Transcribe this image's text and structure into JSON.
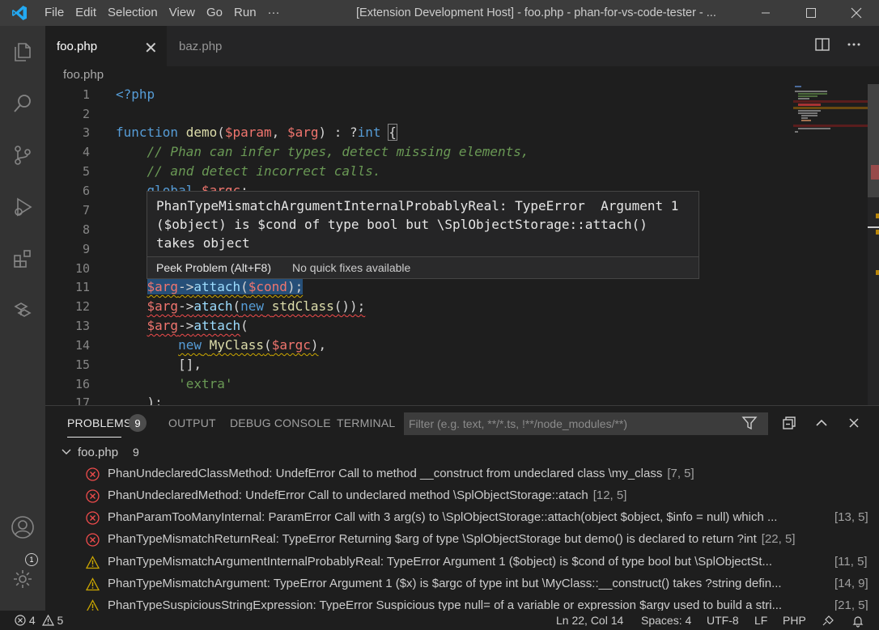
{
  "titlebar": {
    "menus": [
      "File",
      "Edit",
      "Selection",
      "View",
      "Go",
      "Run",
      "···"
    ],
    "window_title": "[Extension Development Host] - foo.php - phan-for-vs-code-tester - ..."
  },
  "tabs": [
    {
      "label": "foo.php",
      "active": true
    },
    {
      "label": "baz.php",
      "active": false
    }
  ],
  "breadcrumb": "foo.php",
  "editor": {
    "line_numbers": [
      "1",
      "2",
      "3",
      "4",
      "5",
      "6",
      "7",
      "8",
      "9",
      "10",
      "11",
      "12",
      "13",
      "14",
      "15",
      "16",
      "17"
    ]
  },
  "hover": {
    "message_line1": "PhanTypeMismatchArgumentInternalProbablyReal: TypeError  Argument 1",
    "message_line2": "($object) is $cond of type bool but \\SplObjectStorage::attach()",
    "message_line3": "takes object",
    "peek_label": "Peek Problem (Alt+F8)",
    "no_fix_label": "No quick fixes available"
  },
  "panel": {
    "tabs": [
      "PROBLEMS",
      "OUTPUT",
      "DEBUG CONSOLE",
      "TERMINAL"
    ],
    "problems_count": "9",
    "filter_placeholder": "Filter (e.g. text, **/*.ts, !**/node_modules/**)",
    "file_group": {
      "name": "foo.php",
      "count": "9"
    },
    "problems": [
      {
        "severity": "error",
        "message": "PhanUndeclaredClassMethod: UndefError Call to method __construct from undeclared class \\my_class",
        "location": "[7, 5]"
      },
      {
        "severity": "error",
        "message": "PhanUndeclaredMethod: UndefError Call to undeclared method \\SplObjectStorage::atach",
        "location": "[12, 5]"
      },
      {
        "severity": "error",
        "message": "PhanParamTooManyInternal: ParamError Call with 3 arg(s) to \\SplObjectStorage::attach(object $object, $info = null) which ...",
        "location": "[13, 5]"
      },
      {
        "severity": "error",
        "message": "PhanTypeMismatchReturnReal: TypeError Returning $arg of type \\SplObjectStorage but demo() is declared to return ?int",
        "location": "[22, 5]"
      },
      {
        "severity": "warning",
        "message": "PhanTypeMismatchArgumentInternalProbablyReal: TypeError Argument 1 ($object) is $cond of type bool but \\SplObjectSt...",
        "location": "[11, 5]"
      },
      {
        "severity": "warning",
        "message": "PhanTypeMismatchArgument: TypeError Argument 1 ($x) is $argc of type int but \\MyClass::__construct() takes ?string defin...",
        "location": "[14, 9]"
      },
      {
        "severity": "warning",
        "message": "PhanTypeSuspiciousStringExpression: TypeError Suspicious type null= of a variable or expression $argv used to build a stri...",
        "location": "[21, 5]"
      }
    ]
  },
  "statusbar": {
    "errors": "4",
    "warnings": "5",
    "position": "Ln 22, Col 14",
    "spaces": "Spaces: 4",
    "encoding": "UTF-8",
    "eol": "LF",
    "language": "PHP"
  },
  "accounts_badge": "1",
  "colors": {
    "error": "#f14c4c",
    "warning": "#cca700",
    "accent": "#007acc"
  }
}
